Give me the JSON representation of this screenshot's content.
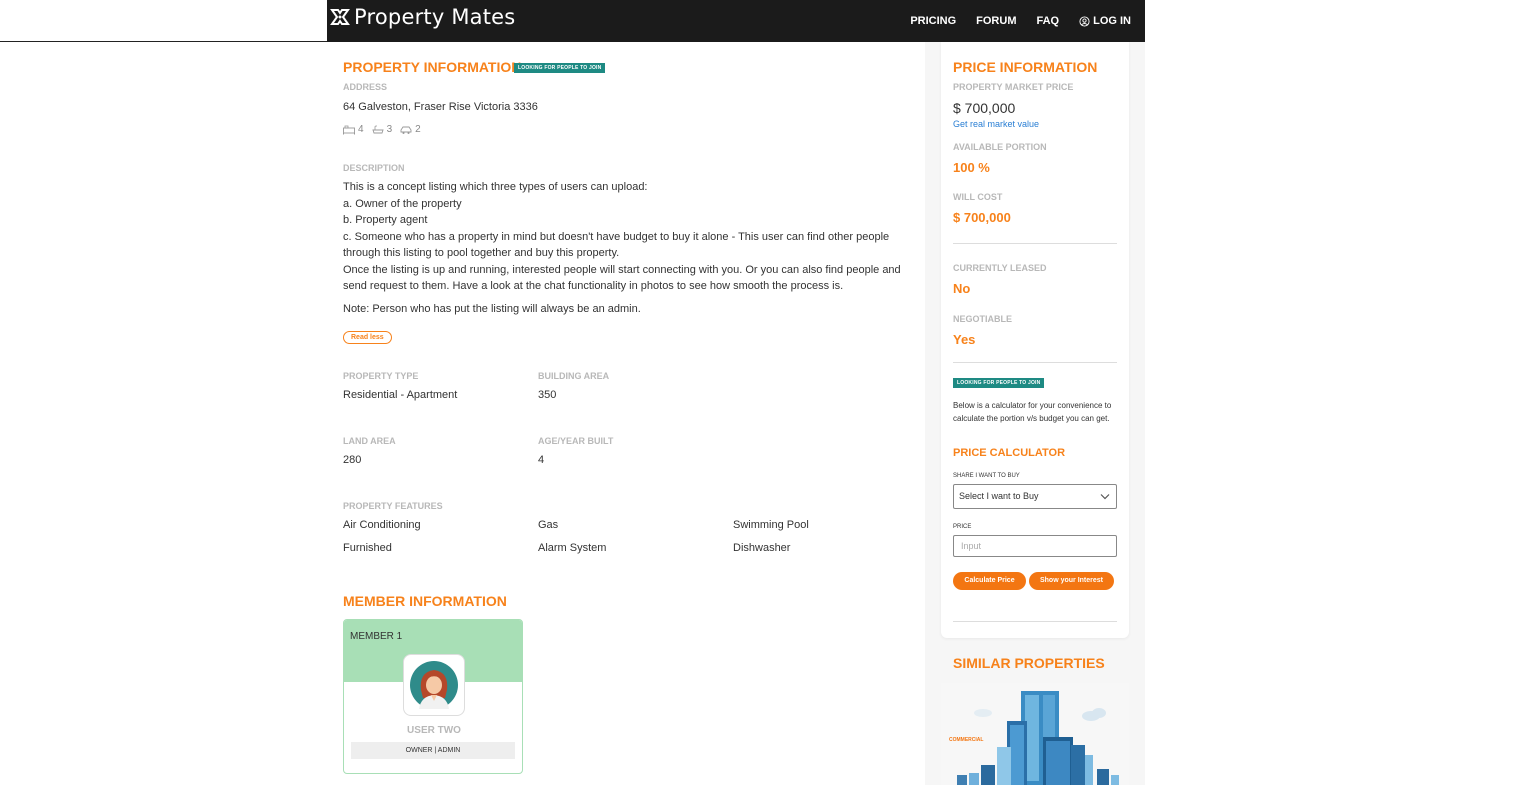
{
  "nav": {
    "brand": "Property Mates",
    "links": [
      "PRICING",
      "FORUM",
      "FAQ"
    ],
    "login": "LOG IN"
  },
  "property": {
    "title": "PROPERTY INFORMATION",
    "badge": "LOOKING FOR PEOPLE TO JOIN",
    "address_label": "ADDRESS",
    "address": "64 Galveston, Fraser Rise Victoria 3336",
    "bedrooms": "4",
    "bathrooms": "3",
    "parking": "2",
    "description_label": "DESCRIPTION",
    "description_lines": [
      "This is a concept listing which three types of users can upload:",
      "a. Owner of the property",
      "b. Property agent",
      "c. Someone who has a property in mind but doesn't have budget to buy it alone - This user can find other people",
      "through this listing to pool together and buy this property.",
      "Once the listing is up and running, interested people will start connecting with you. Or you can also find people and",
      "send request to them. Have a look at the chat functionality in photos to see how smooth the process is."
    ],
    "note": "Note: Person who has put the listing will always be an admin.",
    "read_less": "Read less",
    "type_label": "PROPERTY TYPE",
    "type": "Residential - Apartment",
    "building_area_label": "BUILDING AREA",
    "building_area": "350",
    "land_area_label": "LAND AREA",
    "land_area": "280",
    "age_label": "AGE/YEAR BUILT",
    "age": "4",
    "features_label": "PROPERTY FEATURES",
    "features": [
      "Air Conditioning",
      "Gas",
      "Swimming Pool",
      "Furnished",
      "Alarm System",
      "Dishwasher"
    ]
  },
  "members": {
    "title": "MEMBER INFORMATION",
    "cards": [
      {
        "label": "MEMBER 1",
        "name": "USER TWO",
        "role": "OWNER | ADMIN"
      }
    ]
  },
  "price": {
    "title": "PRICE INFORMATION",
    "market_label": "PROPERTY MARKET PRICE",
    "market_value": "$ 700,000",
    "real_value_link": "Get real market value",
    "portion_label": "AVAILABLE PORTION",
    "portion": "100 %",
    "cost_label": "WILL COST",
    "cost": "$ 700,000",
    "leased_label": "CURRENTLY LEASED",
    "leased": "No",
    "negotiable_label": "NEGOTIABLE",
    "negotiable": "Yes",
    "badge": "LOOKING FOR PEOPLE TO JOIN",
    "calc_intro": "Below is a calculator for your convenience to calculate the portion v/s budget you can get.",
    "calc_title": "PRICE CALCULATOR",
    "share_label": "SHARE I WANT TO BUY",
    "share_select": "Select I want to Buy",
    "price_label": "PRICE",
    "price_placeholder": "Input",
    "calc_button": "Calculate Price",
    "interest_button": "Show your Interest"
  },
  "similar": {
    "title": "SIMILAR PROPERTIES",
    "tag": "COMMERCIAL"
  },
  "colors": {
    "accent": "#f7821b",
    "badge": "#1e8a83",
    "navbar": "#1b1b1b",
    "member_green": "#a8dfb6",
    "link": "#2a7fd4"
  }
}
